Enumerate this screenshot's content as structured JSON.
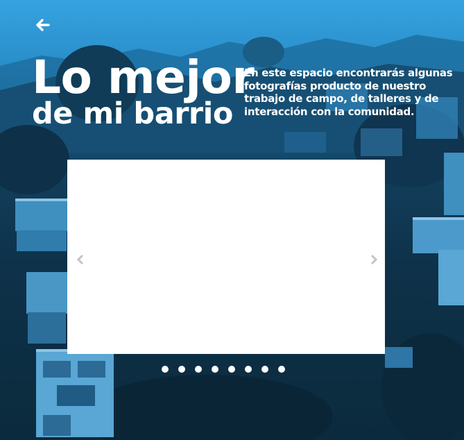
{
  "header": {
    "back_icon": "arrow-left-icon",
    "title_line1": "Lo mejor",
    "title_line2": "de mi barrio",
    "intro": "En este espacio encontrarás algunas fotografías producto de nuestro trabajo de campo, de talleres y de interacción con la comunidad."
  },
  "gallery": {
    "prev_icon": "chevron-left-icon",
    "next_icon": "chevron-right-icon",
    "slide_count": 8,
    "active_slide": 1
  },
  "colors": {
    "overlay_blue": "#2a8fca",
    "text": "#ffffff",
    "arrow": "#c4c4c4"
  }
}
